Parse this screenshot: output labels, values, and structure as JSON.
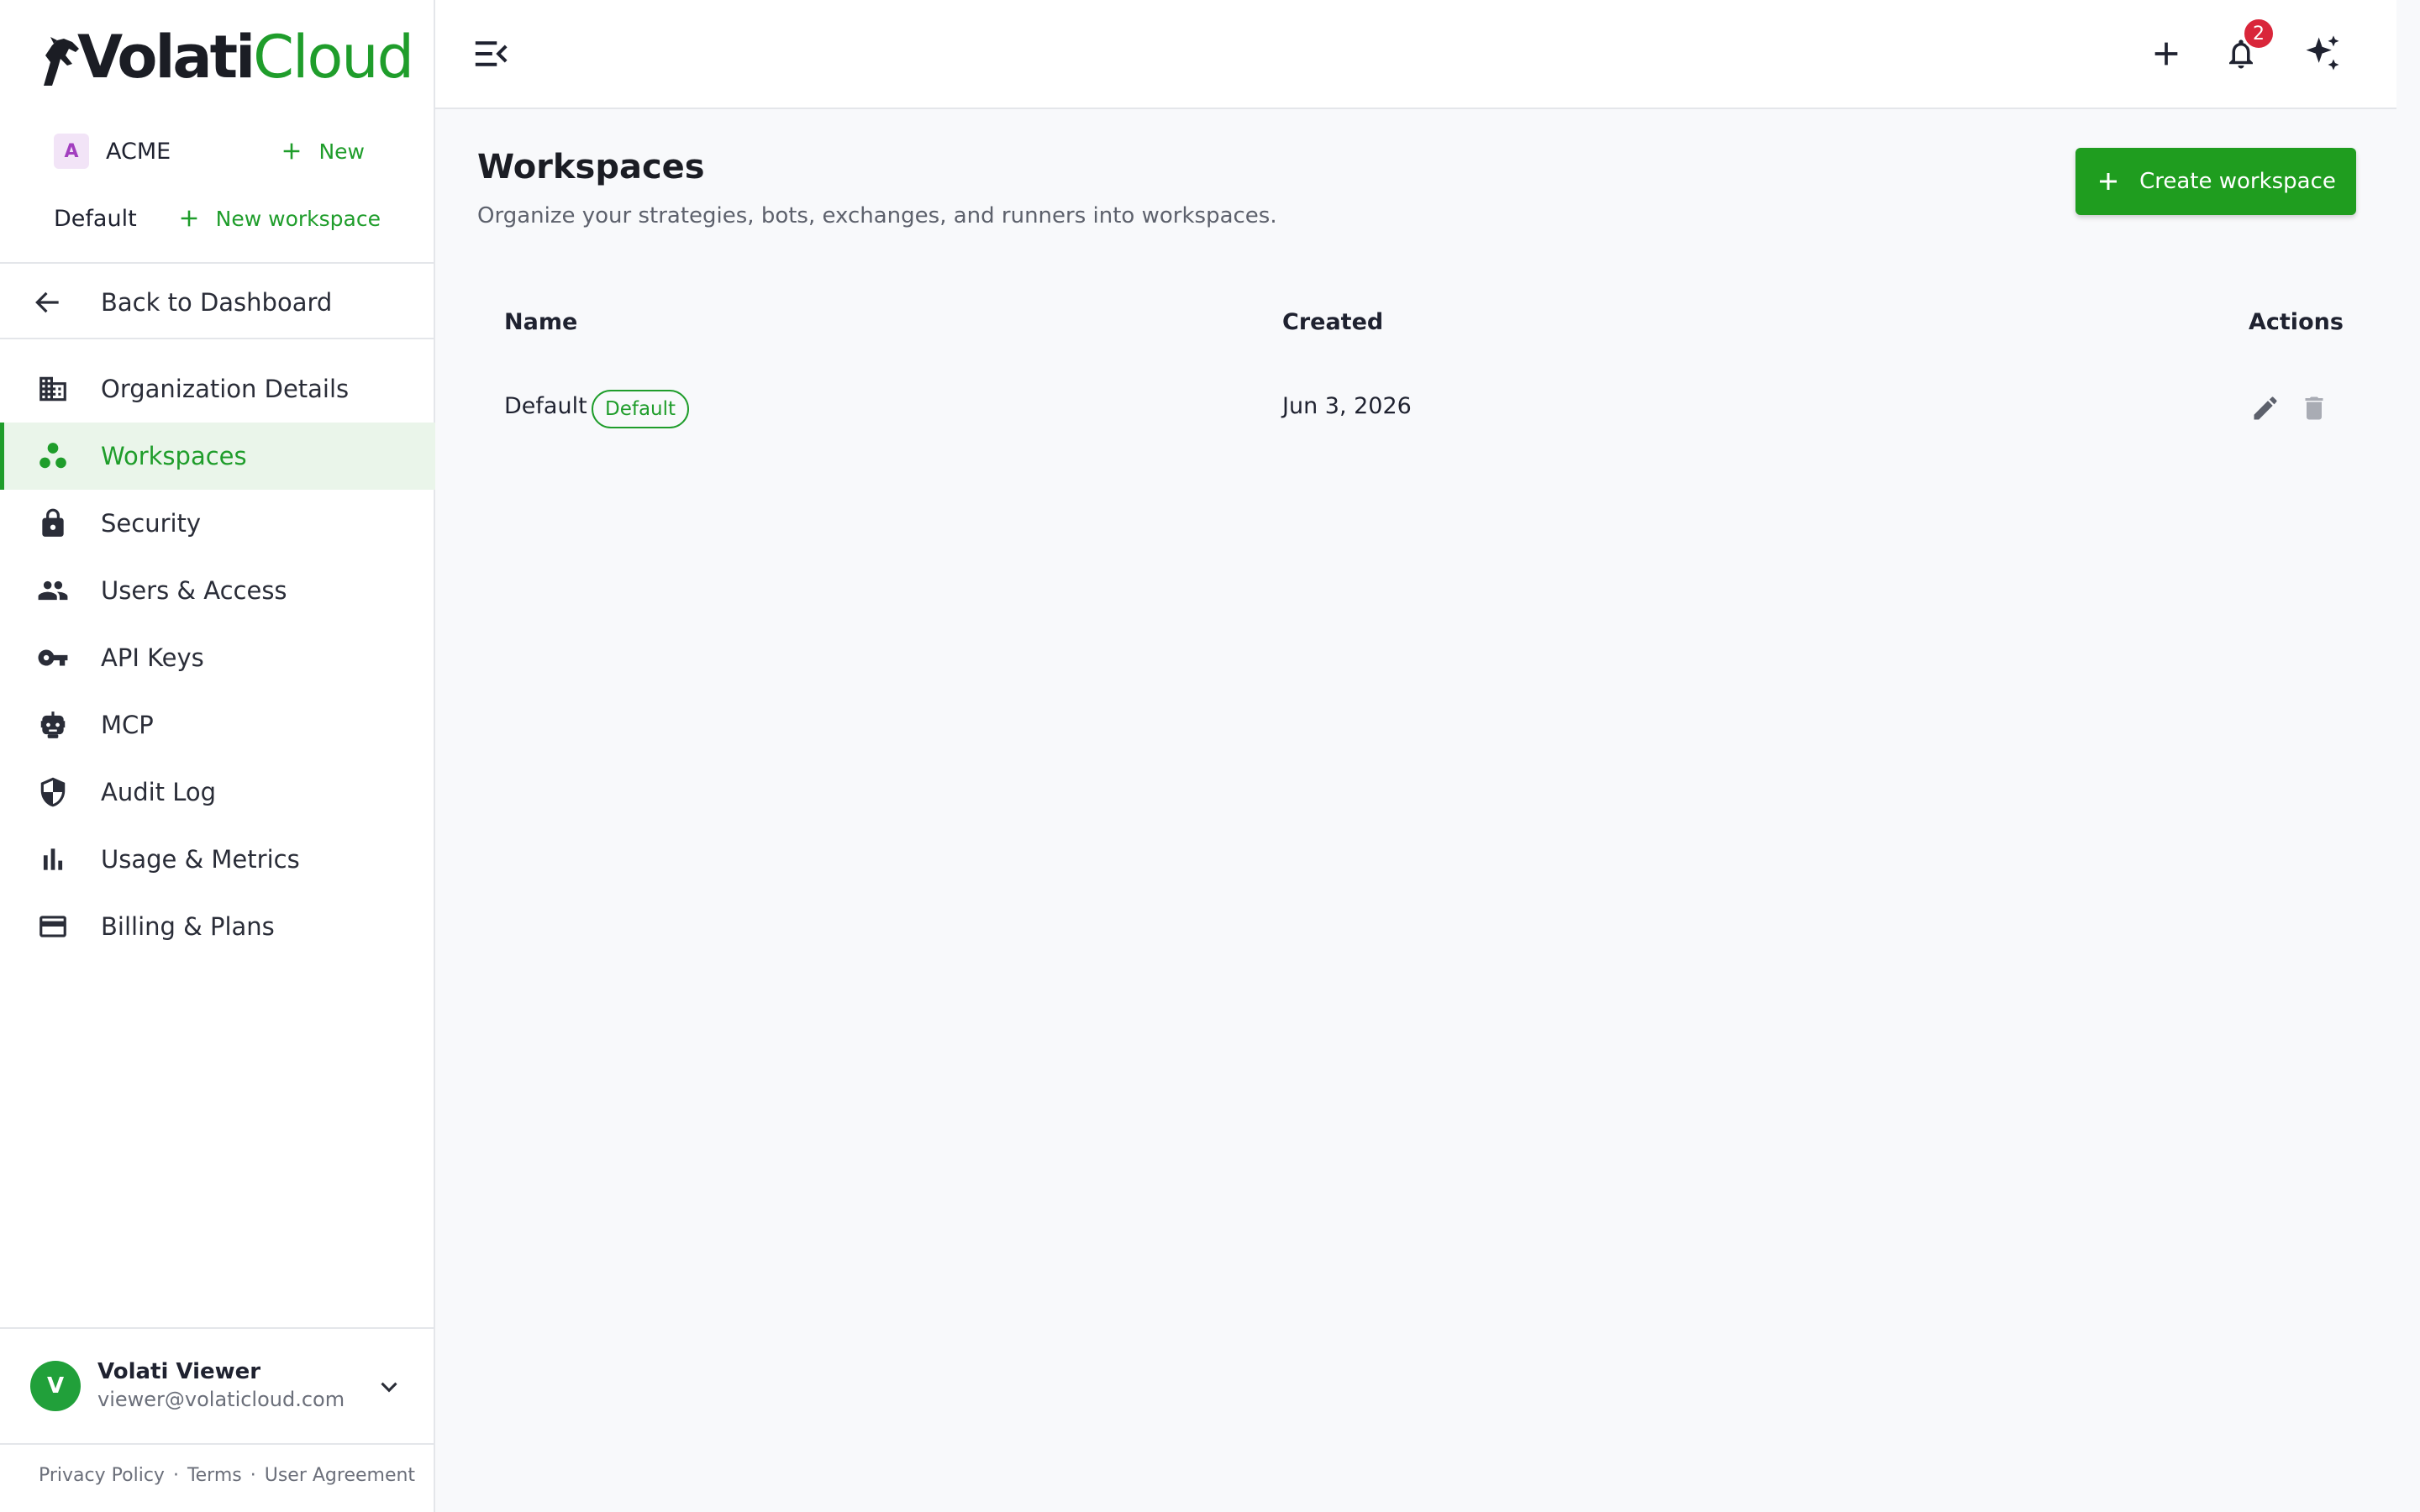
{
  "brand": {
    "name_part1": "Volati",
    "name_part2": "Cloud"
  },
  "org": {
    "badge": "A",
    "name": "ACME",
    "new_label": "New"
  },
  "workspace_switch": {
    "current": "Default",
    "new_label": "New workspace"
  },
  "back": {
    "label": "Back to Dashboard"
  },
  "nav": [
    {
      "label": "Organization Details",
      "icon": "building-icon"
    },
    {
      "label": "Workspaces",
      "icon": "workspaces-icon",
      "active": true
    },
    {
      "label": "Security",
      "icon": "lock-icon"
    },
    {
      "label": "Users & Access",
      "icon": "people-icon"
    },
    {
      "label": "API Keys",
      "icon": "key-icon"
    },
    {
      "label": "MCP",
      "icon": "robot-icon"
    },
    {
      "label": "Audit Log",
      "icon": "shield-icon"
    },
    {
      "label": "Usage & Metrics",
      "icon": "bar-chart-icon"
    },
    {
      "label": "Billing & Plans",
      "icon": "credit-card-icon"
    }
  ],
  "user": {
    "initial": "V",
    "name": "Volati Viewer",
    "email": "viewer@volaticloud.com"
  },
  "legal": {
    "privacy": "Privacy Policy",
    "sep1": "·",
    "terms": "Terms",
    "sep2": "·",
    "agreement": "User Agreement"
  },
  "topbar": {
    "notifications_count": "2"
  },
  "page": {
    "title": "Workspaces",
    "subtitle": "Organize your strategies, bots, exchanges, and runners into workspaces.",
    "create_label": "Create workspace"
  },
  "table": {
    "headers": {
      "name": "Name",
      "created": "Created",
      "actions": "Actions"
    },
    "rows": [
      {
        "name": "Default",
        "chip": "Default",
        "created": "Jun 3, 2026"
      }
    ]
  },
  "colors": {
    "accent": "#1f9d2b",
    "badge_red": "#d9263a",
    "org_badge_bg": "#f2e4f7",
    "org_badge_fg": "#a23fbf"
  }
}
